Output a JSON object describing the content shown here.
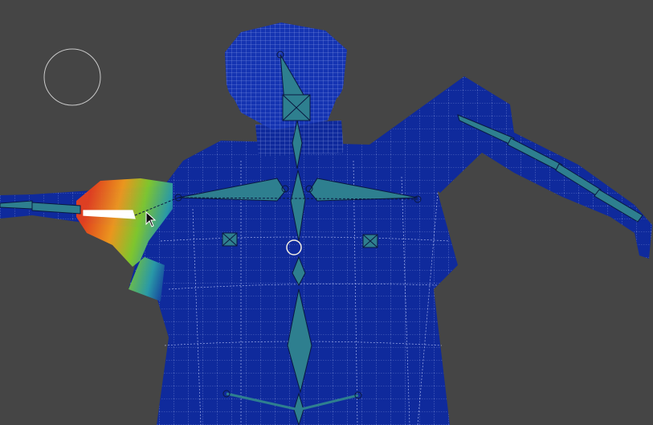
{
  "viewport": {
    "background_color": "#454545",
    "mesh_color": "#0f2a9c",
    "wire_color": "#c8d2ff",
    "bone_color": "#2e7f8f",
    "weight_gradient": [
      "#e8401c",
      "#f39a1c",
      "#82cc2c",
      "#2a9ea8",
      "#0f2a9c"
    ],
    "cursor": "arrow-cursor",
    "brush": "brush-circle-icon"
  }
}
